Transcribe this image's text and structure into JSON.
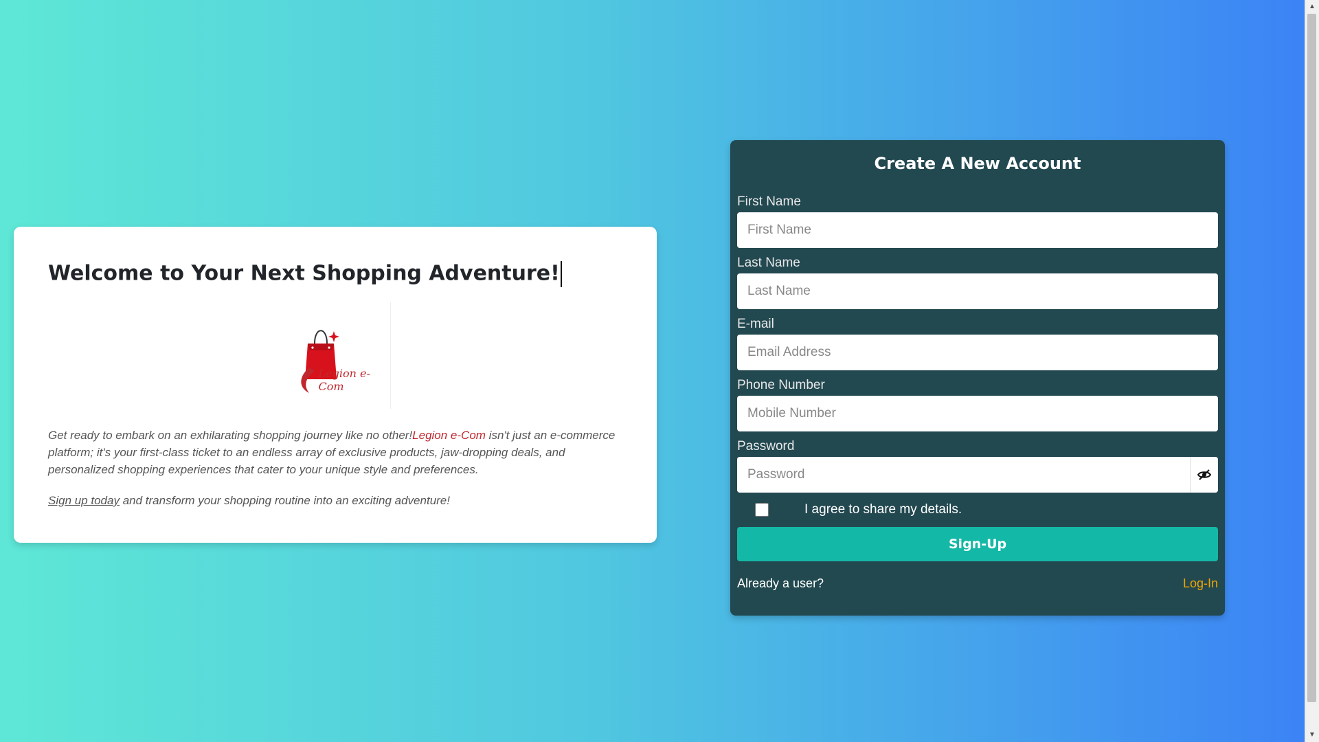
{
  "welcome": {
    "title": "Welcome to Your Next Shopping Adventure!",
    "logo_text": "Legion e-Com",
    "para1_pre": "Get ready to embark on an exhilarating shopping journey like no other!",
    "para1_brand": "Legion e-Com",
    "para1_post": " isn't just an e-commerce platform; it's your first-class ticket to an endless array of exclusive products, jaw-dropping deals, and personalized shopping experiences that cater to your unique style and preferences.",
    "para2_link": "Sign up today",
    "para2_post": " and transform your shopping routine into an exciting adventure!"
  },
  "signup": {
    "title": "Create A New Account",
    "fields": {
      "first_name": {
        "label": "First Name",
        "placeholder": "First Name",
        "value": ""
      },
      "last_name": {
        "label": "Last Name",
        "placeholder": "Last Name",
        "value": ""
      },
      "email": {
        "label": "E-mail",
        "placeholder": "Email Address",
        "value": ""
      },
      "phone": {
        "label": "Phone Number",
        "placeholder": "Mobile Number",
        "value": ""
      },
      "password": {
        "label": "Password",
        "placeholder": "Password",
        "value": ""
      }
    },
    "agree_label": "I agree to share my details.",
    "submit_label": "Sign-Up",
    "already_text": "Already a user?",
    "login_label": "Log-In"
  },
  "colors": {
    "card_bg": "#224850",
    "button": "#14b8a6",
    "login_link": "#f0a500",
    "brand_red": "#c0272d"
  },
  "icons": {
    "password_toggle": "eye-slash-icon",
    "logo": "shopping-bag-icon"
  }
}
